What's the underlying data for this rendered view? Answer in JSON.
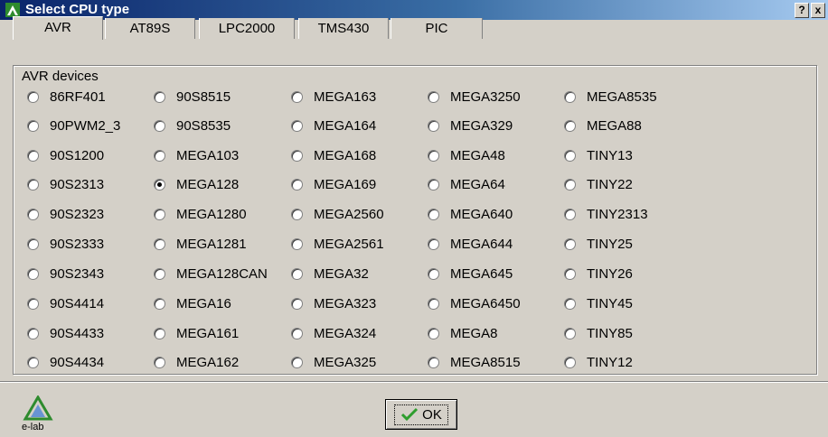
{
  "window": {
    "title": "Select CPU type",
    "help_label": "?",
    "close_label": "x"
  },
  "tabs": [
    {
      "label": "AVR",
      "active": true
    },
    {
      "label": "AT89S",
      "active": false
    },
    {
      "label": "LPC2000",
      "active": false
    },
    {
      "label": "TMS430",
      "active": false
    },
    {
      "label": "PIC",
      "active": false
    }
  ],
  "group": {
    "legend": "AVR devices"
  },
  "columns": [
    [
      "86RF401",
      "90PWM2_3",
      "90S1200",
      "90S2313",
      "90S2323",
      "90S2333",
      "90S2343",
      "90S4414",
      "90S4433",
      "90S4434"
    ],
    [
      "90S8515",
      "90S8535",
      "MEGA103",
      "MEGA128",
      "MEGA1280",
      "MEGA1281",
      "MEGA128CAN",
      "MEGA16",
      "MEGA161",
      "MEGA162"
    ],
    [
      "MEGA163",
      "MEGA164",
      "MEGA168",
      "MEGA169",
      "MEGA2560",
      "MEGA2561",
      "MEGA32",
      "MEGA323",
      "MEGA324",
      "MEGA325"
    ],
    [
      "MEGA3250",
      "MEGA329",
      "MEGA48",
      "MEGA64",
      "MEGA640",
      "MEGA644",
      "MEGA645",
      "MEGA6450",
      "MEGA8",
      "MEGA8515"
    ],
    [
      "MEGA8535",
      "MEGA88",
      "TINY13",
      "TINY22",
      "TINY2313",
      "TINY25",
      "TINY26",
      "TINY45",
      "TINY85",
      "TINY12"
    ]
  ],
  "selected": "MEGA128",
  "ok_button": {
    "label": "OK"
  },
  "logo": {
    "text": "e-lab",
    "icon": "e-lab-logo-icon"
  },
  "colors": {
    "titlebar_start": "#0a246a",
    "titlebar_end": "#a6caf0",
    "check_green": "#2e9e2e"
  }
}
